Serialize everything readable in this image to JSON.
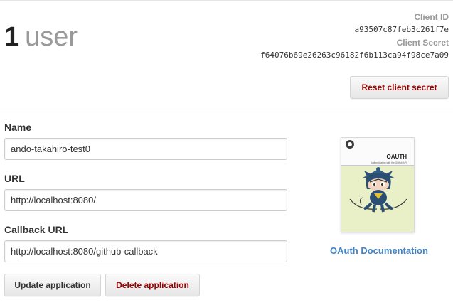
{
  "header": {
    "user_count": "1",
    "user_word": "user",
    "client_id_label": "Client ID",
    "client_id": "a93507c87feb3c261f7e",
    "client_secret_label": "Client Secret",
    "client_secret": "f64076b69e26263c96182f6b113ca94f98ce7a09",
    "reset_button": "Reset client secret"
  },
  "form": {
    "name_label": "Name",
    "name_value": "ando-takahiro-test0",
    "url_label": "URL",
    "url_value": "http://localhost:8080/",
    "callback_label": "Callback URL",
    "callback_value": "http://localhost:8080/github-callback",
    "update_button": "Update application",
    "delete_button": "Delete application"
  },
  "sidebar": {
    "book_title": "OAUTH",
    "book_subtitle": "Authenticating with the GitHub API",
    "doc_link": "OAuth Documentation"
  },
  "colors": {
    "danger_text": "#990000",
    "link": "#4183c4",
    "muted_label": "#999999"
  },
  "icons": {
    "book_cover": "octocat-oauth-illustration",
    "github_logo": "github-octocat-icon"
  }
}
